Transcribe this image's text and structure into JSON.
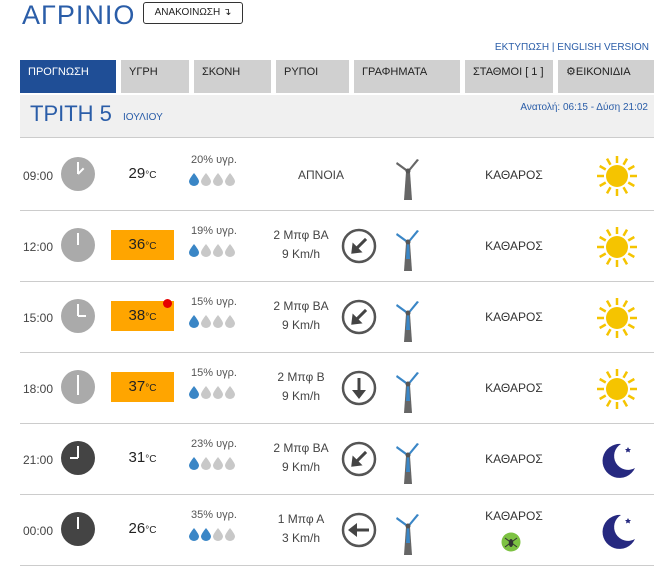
{
  "header": {
    "city": "ΑΓΡΙΝΙΟ",
    "announce_label": "ΑΝΑΚΟΙΝΩΣΗ ↴",
    "print_label": "ΕΚΤΥΠΩΣΗ",
    "link_sep": "|",
    "english_label": "ENGLISH VERSION"
  },
  "tabs": [
    {
      "label": "ΠΡΟΓΝΩΣΗ",
      "active": true
    },
    {
      "label": "ΥΓΡΗ"
    },
    {
      "label": "ΣΚΟΝΗ"
    },
    {
      "label": "ΡΥΠΟΙ"
    },
    {
      "label": "ΓΡΑΦΗΜΑΤΑ"
    },
    {
      "label": "ΣΤΑΘΜΟΙ [ 1 ]"
    },
    {
      "label": "ΕΙΚΟΝΙΔΙΑ",
      "icon": "gear-icon"
    }
  ],
  "day": {
    "name": "ΤΡΙΤΗ 5",
    "month": "ΙΟΥΛΙΟΥ",
    "sun_text": "Ανατολή: 06:15 - Δύση 21:02"
  },
  "temp_unit": "°C",
  "colors": {
    "accent": "#2a5da8",
    "tab_active": "#1f4e96",
    "hot": "#ffa500",
    "alert": "#e60000",
    "sun": "#f5c400",
    "moon": "#262980"
  },
  "forecast": [
    {
      "time": "09:00",
      "clock": "light",
      "temp": "29",
      "hot": false,
      "alert": false,
      "humidity": "20% υγρ.",
      "drops_filled": 1,
      "wind_force": "ΑΠΝΟΙΑ",
      "wind_speed": "",
      "arrow": "none",
      "condition": "ΚΑΘΑΡΟΣ",
      "icon": "sun-icon",
      "mosquito": false
    },
    {
      "time": "12:00",
      "clock": "light",
      "temp": "36",
      "hot": true,
      "alert": false,
      "humidity": "19% υγρ.",
      "drops_filled": 1,
      "wind_force": "2 Μπφ ΒΑ",
      "wind_speed": "9 Km/h",
      "arrow": "sw",
      "condition": "ΚΑΘΑΡΟΣ",
      "icon": "sun-icon",
      "mosquito": false
    },
    {
      "time": "15:00",
      "clock": "light",
      "temp": "38",
      "hot": true,
      "alert": true,
      "humidity": "15% υγρ.",
      "drops_filled": 1,
      "wind_force": "2 Μπφ ΒΑ",
      "wind_speed": "9 Km/h",
      "arrow": "sw",
      "condition": "ΚΑΘΑΡΟΣ",
      "icon": "sun-icon",
      "mosquito": false
    },
    {
      "time": "18:00",
      "clock": "light",
      "temp": "37",
      "hot": true,
      "alert": false,
      "humidity": "15% υγρ.",
      "drops_filled": 1,
      "wind_force": "2 Μπφ Β",
      "wind_speed": "9 Km/h",
      "arrow": "s",
      "condition": "ΚΑΘΑΡΟΣ",
      "icon": "sun-icon",
      "mosquito": false
    },
    {
      "time": "21:00",
      "clock": "dark",
      "temp": "31",
      "hot": false,
      "alert": false,
      "humidity": "23% υγρ.",
      "drops_filled": 1,
      "wind_force": "2 Μπφ ΒΑ",
      "wind_speed": "9 Km/h",
      "arrow": "sw",
      "condition": "ΚΑΘΑΡΟΣ",
      "icon": "moon-icon",
      "mosquito": false
    },
    {
      "time": "00:00",
      "clock": "dark",
      "temp": "26",
      "hot": false,
      "alert": false,
      "humidity": "35% υγρ.",
      "drops_filled": 2,
      "wind_force": "1 Μπφ Α",
      "wind_speed": "3 Km/h",
      "arrow": "w",
      "condition": "ΚΑΘΑΡΟΣ",
      "icon": "moon-icon",
      "mosquito": true
    }
  ]
}
